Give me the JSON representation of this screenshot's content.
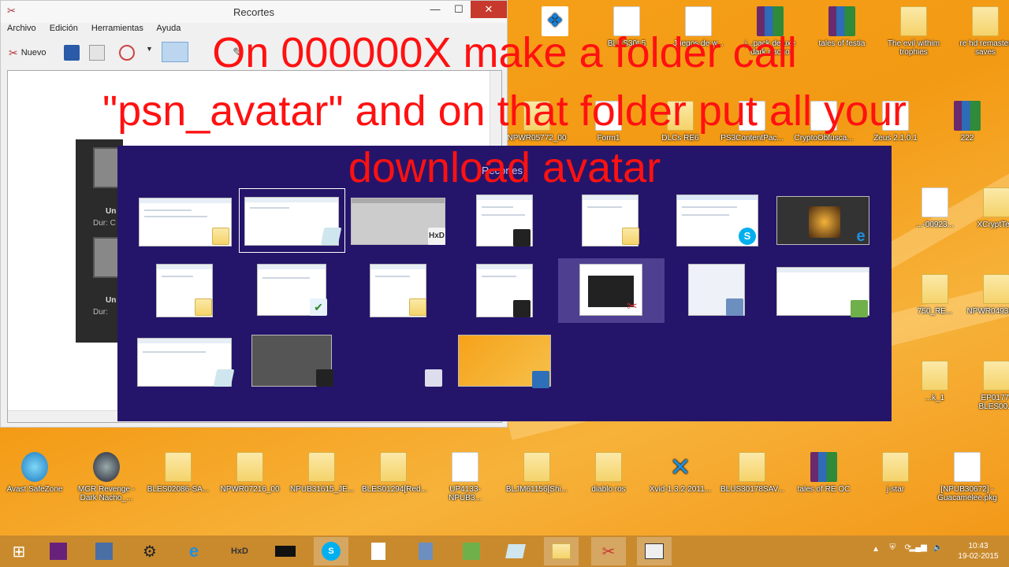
{
  "window": {
    "title": "Recortes",
    "menu": [
      "Archivo",
      "Edición",
      "Herramientas",
      "Ayuda"
    ],
    "new_label": "Nuevo"
  },
  "switcher": {
    "title": "Recortes"
  },
  "desktop_dark_preview": {
    "label1": "Un",
    "label2": "Dur: C",
    "label3": "Un",
    "label4": "Dur:"
  },
  "overlay_text": {
    "line1": "On 000000X  make a folder call",
    "line2": "\"psn_avatar\" and on that folder put all your",
    "line3": "download avatar"
  },
  "desktop_icons_top": [
    {
      "label": "",
      "kind": "dropbox"
    },
    {
      "label": "BLUS30t 5",
      "kind": "doc"
    },
    {
      "label": "Juegos de w...",
      "kind": "doc"
    },
    {
      "label": "j...pack deluxe dark nacho",
      "kind": "rar"
    },
    {
      "label": "tales of festia",
      "kind": "rar"
    },
    {
      "label": "The evil withim trophies",
      "kind": "folder"
    },
    {
      "label": "re hd remaster saves",
      "kind": "folder"
    }
  ],
  "desktop_icons_row2": [
    {
      "label": "NPWR05772_00",
      "kind": "folder"
    },
    {
      "label": "Form1",
      "kind": "doc"
    },
    {
      "label": "DLCs RE6",
      "kind": "folder"
    },
    {
      "label": "PS3ContentPac...",
      "kind": "doc"
    },
    {
      "label": "CryptoObfusca...",
      "kind": "doc"
    },
    {
      "label": "Zeus 2.1.0.1",
      "kind": "doc"
    },
    {
      "label": "222",
      "kind": "rar"
    }
  ],
  "desktop_icons_right": [
    {
      "label": "...-00923...",
      "kind": "doc"
    },
    {
      "label": "XCryptTest",
      "kind": "folder"
    },
    {
      "label": "750_RE...",
      "kind": "folder"
    },
    {
      "label": "NPWR04936_00",
      "kind": "folder"
    },
    {
      "label": "...k_1",
      "kind": "folder"
    },
    {
      "label": "EP0177-BLES00...",
      "kind": "folder"
    }
  ],
  "desktop_icons_bottom": [
    {
      "label": "Avast SafeZone",
      "kind": "avast"
    },
    {
      "label": "MGR Revenge - Dark Nacho_...",
      "kind": "mgr"
    },
    {
      "label": "BLES02086-SA...",
      "kind": "folder"
    },
    {
      "label": "NPWR07216_00",
      "kind": "folder"
    },
    {
      "label": "NPUB31615_JE...",
      "kind": "folder"
    },
    {
      "label": "BLES01294[Red...",
      "kind": "folder"
    },
    {
      "label": "UP4133-NPUB3...",
      "kind": "doc"
    },
    {
      "label": "BLJM61156[Shi...",
      "kind": "folder"
    },
    {
      "label": "diablo ros",
      "kind": "folder"
    },
    {
      "label": "Xvid-1.3.2-2011...",
      "kind": "xvid"
    },
    {
      "label": "BLUS30178SAV...",
      "kind": "folder"
    },
    {
      "label": "tales of RE OC",
      "kind": "rar"
    },
    {
      "label": "j-star",
      "kind": "folder"
    },
    {
      "label": "[NPUB30672] - Guacamelee.pkg",
      "kind": "doc"
    }
  ],
  "clock": {
    "time": "10:43",
    "date": "19-02-2015"
  },
  "colors": {
    "switcher_bg": "#25156a",
    "overlay_text": "#ff1111",
    "taskbar": "#c98a2e"
  }
}
